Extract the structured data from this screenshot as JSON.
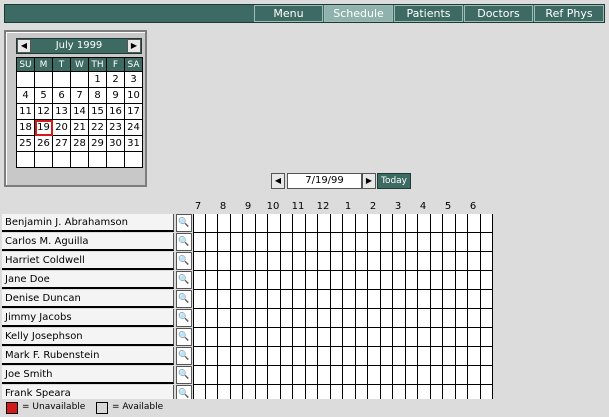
{
  "nav": {
    "items": [
      {
        "label": "Menu",
        "active": false
      },
      {
        "label": "Schedule",
        "active": true
      },
      {
        "label": "Patients",
        "active": false
      },
      {
        "label": "Doctors",
        "active": false
      },
      {
        "label": "Ref Phys",
        "active": false
      }
    ]
  },
  "calendar": {
    "month_label": "July 1999",
    "prev_icon": "◀",
    "next_icon": "▶",
    "weekdays": [
      "SU",
      "M",
      "T",
      "W",
      "TH",
      "F",
      "SA"
    ],
    "weeks": [
      [
        "",
        "",
        "",
        "",
        "1",
        "2",
        "3"
      ],
      [
        "4",
        "5",
        "6",
        "7",
        "8",
        "9",
        "10"
      ],
      [
        "11",
        "12",
        "13",
        "14",
        "15",
        "16",
        "17"
      ],
      [
        "18",
        "19",
        "20",
        "21",
        "22",
        "23",
        "24"
      ],
      [
        "25",
        "26",
        "27",
        "28",
        "29",
        "30",
        "31"
      ],
      [
        "",
        "",
        "",
        "",
        "",
        "",
        ""
      ]
    ],
    "selected_day": "19"
  },
  "date_control": {
    "value": "7/19/99",
    "today_label": "Today",
    "prev_icon": "◀",
    "next_icon": "▶"
  },
  "schedule": {
    "hours": [
      "7",
      "8",
      "9",
      "10",
      "11",
      "12",
      "1",
      "2",
      "3",
      "4",
      "5",
      "6"
    ],
    "slots_per_hour": 2,
    "search_icon": "🔍",
    "doctors": [
      "Benjamin J. Abrahamson",
      "Carlos M. Aguilla",
      "Harriet Coldwell",
      "Jane Doe",
      "Denise Duncan",
      "Jimmy Jacobs",
      "Kelly Josephson",
      "Mark F. Rubenstein",
      "Joe Smith",
      "Frank Speara"
    ]
  },
  "legend": {
    "unavailable_label": "= Unavailable",
    "available_label": "= Available",
    "unavailable_color": "#d21a1a",
    "available_color": "#d8d8d8"
  }
}
